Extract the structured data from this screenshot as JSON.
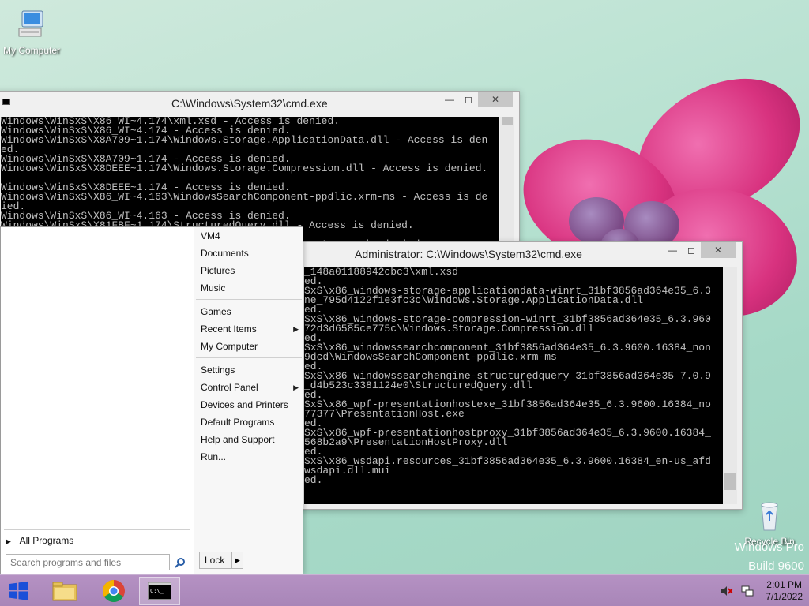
{
  "desktop": {
    "icons": [
      {
        "label": "My Computer"
      },
      {
        "label": "Recycle Bin"
      }
    ],
    "watermark": [
      "Windows Pro",
      "Build 9600"
    ]
  },
  "windows": [
    {
      "title": "C:\\Windows\\System32\\cmd.exe",
      "lines": [
        "Windows\\WinSxS\\X86_WI~4.174\\xml.xsd - Access is denied.",
        "Windows\\WinSxS\\X86_WI~4.174 - Access is denied.",
        "Windows\\WinSxS\\X8A709~1.174\\Windows.Storage.ApplicationData.dll - Access is den",
        "ed.",
        "Windows\\WinSxS\\X8A709~1.174 - Access is denied.",
        "Windows\\WinSxS\\X8DEEE~1.174\\Windows.Storage.Compression.dll - Access is denied.",
        "",
        "Windows\\WinSxS\\X8DEEE~1.174 - Access is denied.",
        "Windows\\WinSxS\\X86_WI~4.163\\WindowsSearchComponent-ppdlic.xrm-ms - Access is de",
        "ied.",
        "Windows\\WinSxS\\X86_WI~4.163 - Access is denied.",
        "Windows\\WinSxS\\X81FBF~1.174\\StructuredQuery.dll - Access is denied.",
        "",
        "                                                  - Access is denied."
      ]
    },
    {
      "title": "Administrator: C:\\Windows\\System32\\cmd.exe",
      "lines": [
        "_148a01188942cbc3\\xml.xsd",
        "ed.",
        "SxS\\x86_windows-storage-applicationdata-winrt_31bf3856ad364e35_6.3",
        "ne_795d4122f1e3fc3c\\Windows.Storage.ApplicationData.dll",
        "ed.",
        "SxS\\x86_windows-storage-compression-winrt_31bf3856ad364e35_6.3.960",
        "72d3d6585ce775c\\Windows.Storage.Compression.dll",
        "ed.",
        "SxS\\x86_windowssearchcomponent_31bf3856ad364e35_6.3.9600.16384_non",
        "9dcd\\WindowsSearchComponent-ppdlic.xrm-ms",
        "ed.",
        "SxS\\x86_windowssearchengine-structuredquery_31bf3856ad364e35_7.0.9",
        "_d4b523c3381124e0\\StructuredQuery.dll",
        "ed.",
        "SxS\\x86_wpf-presentationhostexe_31bf3856ad364e35_6.3.9600.16384_no",
        "77377\\PresentationHost.exe",
        "ed.",
        "SxS\\x86_wpf-presentationhostproxy_31bf3856ad364e35_6.3.9600.16384_",
        "568b2a9\\PresentationHostProxy.dll",
        "ed.",
        "SxS\\x86_wsdapi.resources_31bf3856ad364e35_6.3.9600.16384_en-us_afd",
        "wsdapi.dll.mui",
        "ed.",
        "",
        "",
        "tem32>"
      ]
    }
  ],
  "start_menu": {
    "right_items": {
      "vm4": "VM4",
      "documents": "Documents",
      "pictures": "Pictures",
      "music": "Music",
      "games": "Games",
      "recent_items": "Recent Items",
      "my_computer": "My Computer",
      "settings": "Settings",
      "control_panel": "Control Panel",
      "devices_printers": "Devices and Printers",
      "default_programs": "Default Programs",
      "help_support": "Help and Support",
      "run": "Run..."
    },
    "all_programs": "All Programs",
    "search_placeholder": "Search programs and files",
    "lock_label": "Lock"
  },
  "taskbar": {
    "clock_time": "2:01 PM",
    "clock_date": "7/1/2022",
    "pinned": [
      "windows-logo",
      "file-explorer",
      "chrome",
      "cmd"
    ]
  },
  "colors": {
    "taskbar": "#a886b8",
    "console_bg": "#000000",
    "console_fg": "#c0c0c0"
  }
}
